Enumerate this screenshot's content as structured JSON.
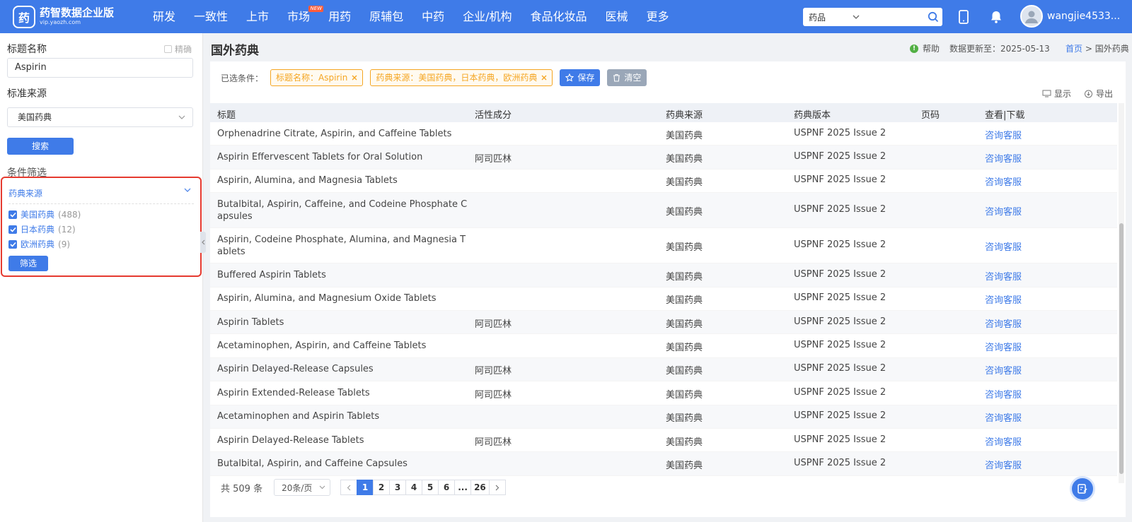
{
  "app": {
    "logo_mark": "药",
    "logo_title": "药智数据企业版",
    "logo_sub": "vip.yaozh.com"
  },
  "nav": [
    {
      "label": "研发"
    },
    {
      "label": "一致性"
    },
    {
      "label": "上市"
    },
    {
      "label": "市场",
      "badge": "NEW"
    },
    {
      "label": "用药"
    },
    {
      "label": "原辅包"
    },
    {
      "label": "中药"
    },
    {
      "label": "企业/机构"
    },
    {
      "label": "食品化妆品"
    },
    {
      "label": "医械"
    },
    {
      "label": "更多"
    }
  ],
  "search": {
    "category": "药品",
    "value": ""
  },
  "user": {
    "name": "wangjie4533..."
  },
  "sidebar": {
    "title_label": "标题名称",
    "exact_label": "精确",
    "title_value": "Aspirin",
    "source_label": "标准来源",
    "source_value": "美国药典",
    "search_button": "搜索",
    "filter_heading": "条件筛选",
    "filter_group": "药典来源",
    "options": [
      {
        "label": "美国药典",
        "count": "(488)"
      },
      {
        "label": "日本药典",
        "count": "(12)"
      },
      {
        "label": "欧洲药典",
        "count": "(9)"
      }
    ],
    "filter_button": "筛选"
  },
  "page": {
    "title": "国外药典",
    "help": "帮助",
    "updated": "数据更新至：2025-05-13",
    "breadcrumb_home": "首页",
    "breadcrumb_sep": ">",
    "breadcrumb_current": "国外药典"
  },
  "conditions": {
    "label": "已选条件：",
    "tags": [
      "标题名称：Aspirin",
      "药典来源：美国药典，日本药典，欧洲药典"
    ],
    "save": "保存",
    "clear": "清空",
    "show": "显示",
    "export": "导出"
  },
  "table": {
    "headers": [
      "标题",
      "活性成分",
      "药典来源",
      "药典版本",
      "页码",
      "查看|下载"
    ],
    "rows": [
      {
        "title": "Orphenadrine Citrate, Aspirin, and Caffeine Tablets",
        "ingredient": "",
        "source": "美国药典",
        "version": "USPNF 2025 Issue 2",
        "page": "",
        "action": "咨询客服"
      },
      {
        "title": "Aspirin Effervescent Tablets for Oral Solution",
        "ingredient": "阿司匹林",
        "source": "美国药典",
        "version": "USPNF 2025 Issue 2",
        "page": "",
        "action": "咨询客服"
      },
      {
        "title": "Aspirin, Alumina, and Magnesia Tablets",
        "ingredient": "",
        "source": "美国药典",
        "version": "USPNF 2025 Issue 2",
        "page": "",
        "action": "咨询客服"
      },
      {
        "title": "Butalbital, Aspirin, Caffeine, and Codeine Phosphate Capsules",
        "ingredient": "",
        "source": "美国药典",
        "version": "USPNF 2025 Issue 2",
        "page": "",
        "action": "咨询客服"
      },
      {
        "title": "Aspirin, Codeine Phosphate, Alumina, and Magnesia Tablets",
        "ingredient": "",
        "source": "美国药典",
        "version": "USPNF 2025 Issue 2",
        "page": "",
        "action": "咨询客服"
      },
      {
        "title": "Buffered Aspirin Tablets",
        "ingredient": "",
        "source": "美国药典",
        "version": "USPNF 2025 Issue 2",
        "page": "",
        "action": "咨询客服"
      },
      {
        "title": "Aspirin, Alumina, and Magnesium Oxide Tablets",
        "ingredient": "",
        "source": "美国药典",
        "version": "USPNF 2025 Issue 2",
        "page": "",
        "action": "咨询客服"
      },
      {
        "title": "Aspirin Tablets",
        "ingredient": "阿司匹林",
        "source": "美国药典",
        "version": "USPNF 2025 Issue 2",
        "page": "",
        "action": "咨询客服"
      },
      {
        "title": "Acetaminophen, Aspirin, and Caffeine Tablets",
        "ingredient": "",
        "source": "美国药典",
        "version": "USPNF 2025 Issue 2",
        "page": "",
        "action": "咨询客服"
      },
      {
        "title": "Aspirin Delayed-Release Capsules",
        "ingredient": "阿司匹林",
        "source": "美国药典",
        "version": "USPNF 2025 Issue 2",
        "page": "",
        "action": "咨询客服"
      },
      {
        "title": "Aspirin Extended-Release Tablets",
        "ingredient": "阿司匹林",
        "source": "美国药典",
        "version": "USPNF 2025 Issue 2",
        "page": "",
        "action": "咨询客服"
      },
      {
        "title": "Acetaminophen and Aspirin Tablets",
        "ingredient": "",
        "source": "美国药典",
        "version": "USPNF 2025 Issue 2",
        "page": "",
        "action": "咨询客服"
      },
      {
        "title": "Aspirin Delayed-Release Tablets",
        "ingredient": "阿司匹林",
        "source": "美国药典",
        "version": "USPNF 2025 Issue 2",
        "page": "",
        "action": "咨询客服"
      },
      {
        "title": "Butalbital, Aspirin, and Caffeine Capsules",
        "ingredient": "",
        "source": "美国药典",
        "version": "USPNF 2025 Issue 2",
        "page": "",
        "action": "咨询客服"
      }
    ]
  },
  "pagination": {
    "total": "共 509 条",
    "page_size": "20条/页",
    "pages": [
      "1",
      "2",
      "3",
      "4",
      "5",
      "6",
      "...",
      "26"
    ],
    "current": "1"
  },
  "colors": {
    "primary": "#3f7be8",
    "tag": "#f5a623",
    "highlight_border": "#e53a2f"
  }
}
